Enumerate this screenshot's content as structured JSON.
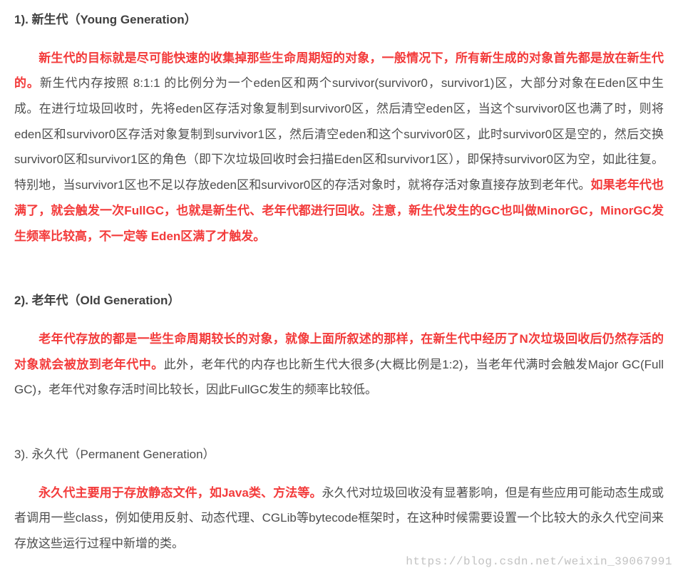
{
  "section1": {
    "heading": "1). 新生代（Young Generation）",
    "p1_red1": "新生代的目标就是尽可能快速的收集掉那些生命周期短的对象，一般情况下，所有新生成的对象首先都是放在新生代的。",
    "p1_body": "新生代内存按照 8:1:1 的比例分为一个eden区和两个survivor(survivor0，survivor1)区，大部分对象在Eden区中生成。在进行垃圾回收时，先将eden区存活对象复制到survivor0区，然后清空eden区，当这个survivor0区也满了时，则将eden区和survivor0区存活对象复制到survivor1区，然后清空eden和这个survivor0区，此时survivor0区是空的，然后交换survivor0区和survivor1区的角色（即下次垃圾回收时会扫描Eden区和survivor1区），即保持survivor0区为空，如此往复。特别地，当survivor1区也不足以存放eden区和survivor0区的存活对象时，就将存活对象直接存放到老年代。",
    "p1_red2": "如果老年代也满了，就会触发一次FullGC，也就是新生代、老年代都进行回收。注意，新生代发生的GC也叫做MinorGC，MinorGC发生频率比较高，不一定等 Eden区满了才触发。"
  },
  "section2": {
    "heading": "2). 老年代（Old Generation）",
    "p1_red1": "老年代存放的都是一些生命周期较长的对象，就像上面所叙述的那样，在新生代中经历了N次垃圾回收后仍然存活的对象就会被放到老年代中。",
    "p1_body": "此外，老年代的内存也比新生代大很多(大概比例是1:2)，当老年代满时会触发Major GC(Full GC)，老年代对象存活时间比较长，因此FullGC发生的频率比较低。"
  },
  "section3": {
    "heading": "3). 永久代（Permanent Generation）",
    "p1_red1": "永久代主要用于存放静态文件，如Java类、方法等。",
    "p1_body": "永久代对垃圾回收没有显著影响，但是有些应用可能动态生成或者调用一些class，例如使用反射、动态代理、CGLib等bytecode框架时，在这种时候需要设置一个比较大的永久代空间来存放这些运行过程中新增的类。"
  },
  "watermark": "https://blog.csdn.net/weixin_39067991"
}
